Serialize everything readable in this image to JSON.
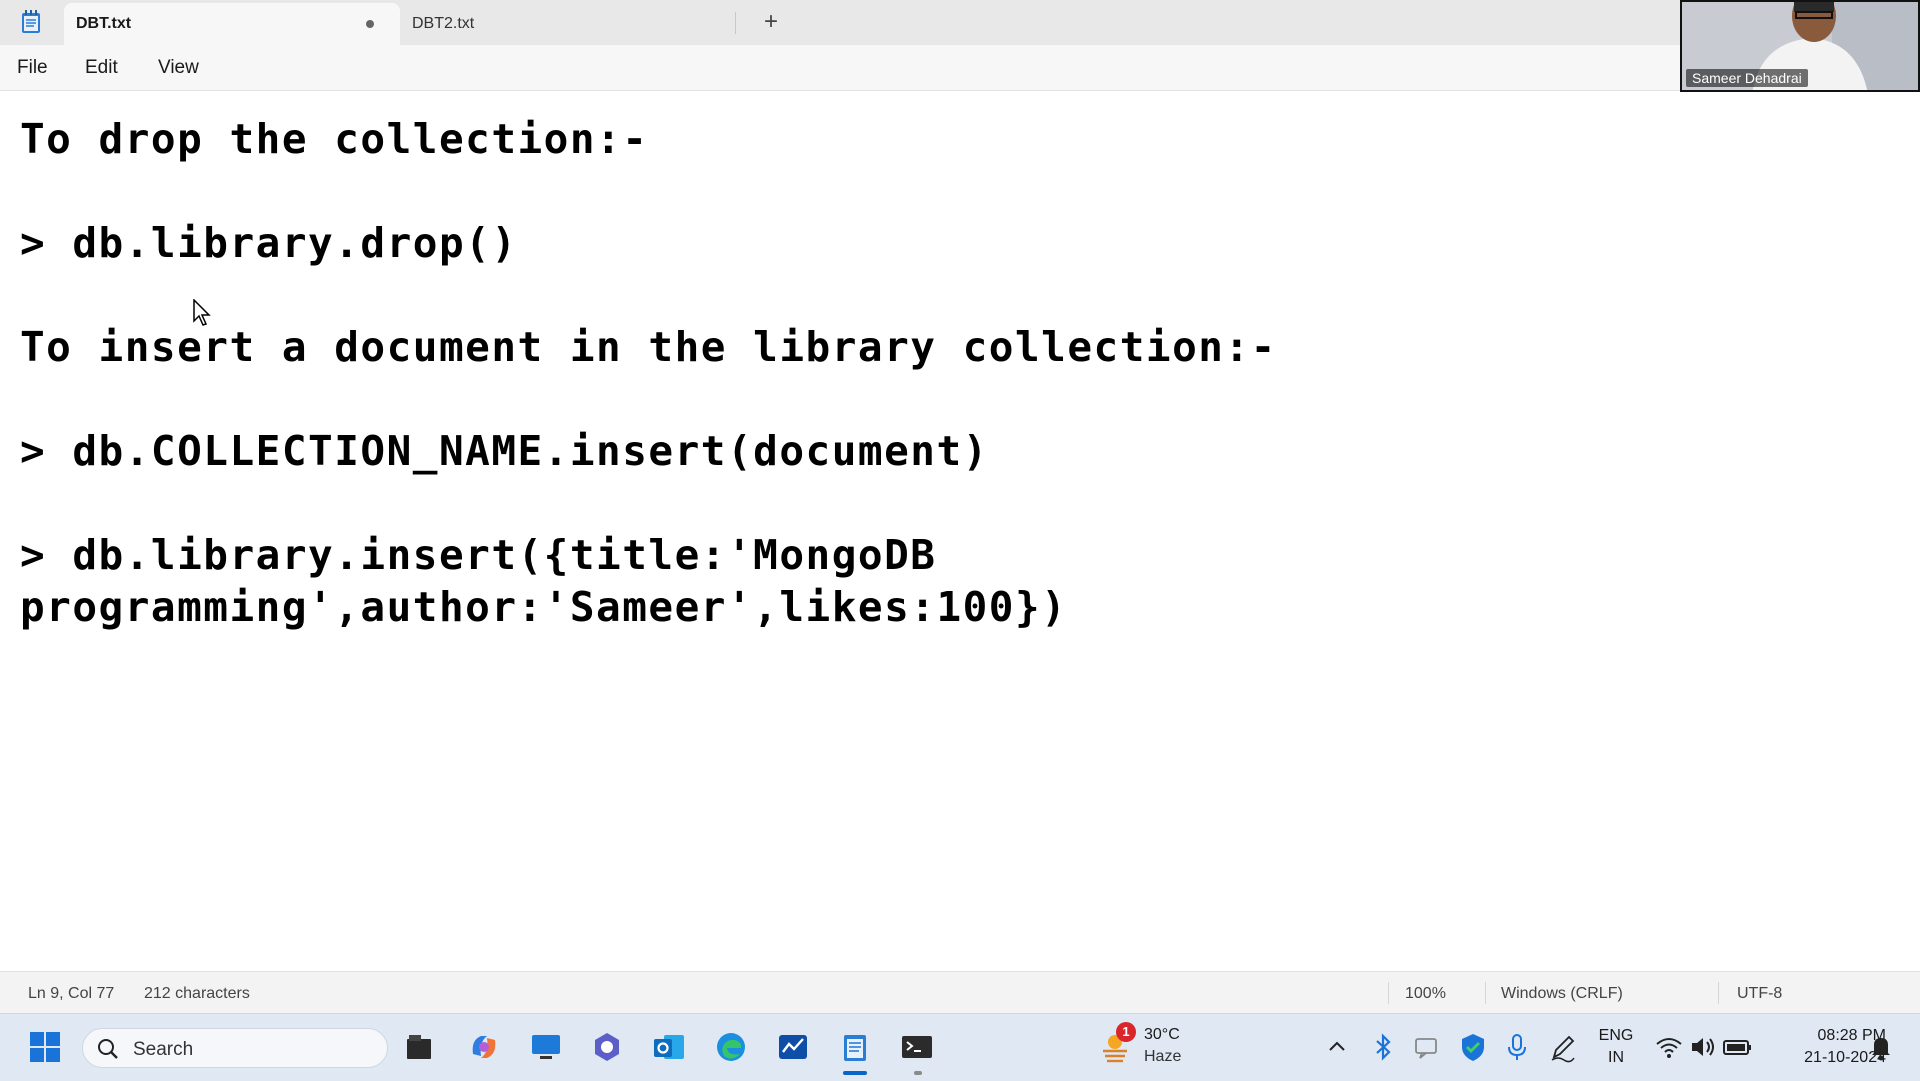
{
  "tabs": [
    {
      "label": "DBT.txt",
      "active": true,
      "unsaved": true
    },
    {
      "label": "DBT2.txt",
      "active": false,
      "unsaved": false
    }
  ],
  "new_tab_glyph": "+",
  "menu": [
    "File",
    "Edit",
    "View"
  ],
  "editor_lines": [
    "To drop the collection:-",
    "> db.library.drop()",
    "To insert a document in the library collection:-",
    "> db.COLLECTION_NAME.insert(document)",
    "> db.library.insert({title:'MongoDB",
    "programming',author:'Sameer',likes:100})"
  ],
  "status": {
    "position": "Ln 9, Col 77",
    "characters": "212 characters",
    "zoom": "100%",
    "line_ending": "Windows (CRLF)",
    "encoding": "UTF-8"
  },
  "taskbar": {
    "search_placeholder": "Search",
    "weather_temp": "30°C",
    "weather_condition": "Haze",
    "weather_badge": "1",
    "language_top": "ENG",
    "language_bottom": "IN",
    "time": "08:28 PM",
    "date": "21-10-2024"
  },
  "webcam": {
    "name": "Sameer Dehadrai"
  },
  "colors": {
    "accent": "#0a64c8",
    "taskbar_bg": "#dfe8f3",
    "badge": "#d9262c"
  }
}
